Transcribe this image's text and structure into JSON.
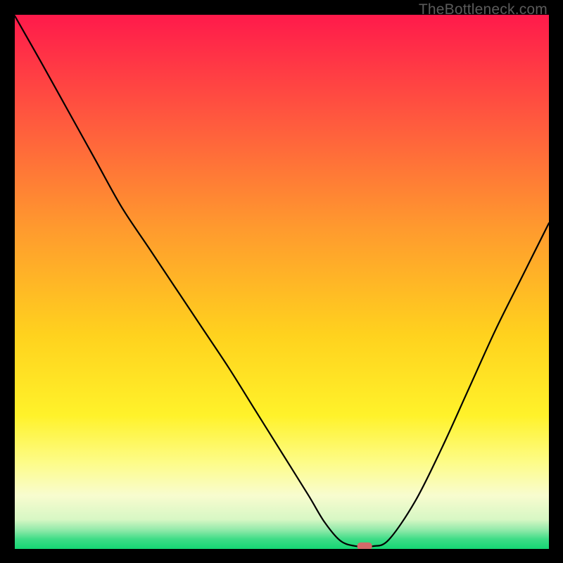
{
  "attribution": "TheBottleneck.com",
  "chart_data": {
    "type": "line",
    "title": "",
    "xlabel": "",
    "ylabel": "",
    "xlim": [
      0,
      100
    ],
    "ylim": [
      0,
      100
    ],
    "series": [
      {
        "name": "bottleneck-curve",
        "x": [
          0,
          5,
          10,
          15,
          20,
          25,
          30,
          35,
          40,
          45,
          50,
          55,
          58,
          61,
          64,
          67,
          70,
          75,
          80,
          85,
          90,
          95,
          100
        ],
        "y": [
          99.8,
          91,
          82,
          73,
          64,
          56.5,
          49,
          41.5,
          34,
          26,
          18,
          10,
          5,
          1.5,
          0.5,
          0.5,
          1.7,
          9,
          19,
          30,
          41,
          51,
          61
        ]
      }
    ],
    "marker": {
      "name": "optimal-point",
      "x": 65.5,
      "y": 0.5,
      "color": "#d46a6a"
    },
    "background": {
      "type": "vertical-gradient",
      "stops": [
        {
          "pos": 0.0,
          "color": "#ff1a4b"
        },
        {
          "pos": 0.2,
          "color": "#ff5a3e"
        },
        {
          "pos": 0.4,
          "color": "#ff9a2e"
        },
        {
          "pos": 0.6,
          "color": "#ffd21e"
        },
        {
          "pos": 0.75,
          "color": "#fff22a"
        },
        {
          "pos": 0.84,
          "color": "#fdfc8a"
        },
        {
          "pos": 0.9,
          "color": "#f8fccf"
        },
        {
          "pos": 0.945,
          "color": "#d7f7c4"
        },
        {
          "pos": 0.965,
          "color": "#8fe9a9"
        },
        {
          "pos": 0.982,
          "color": "#3ddc86"
        },
        {
          "pos": 1.0,
          "color": "#15d673"
        }
      ]
    }
  }
}
